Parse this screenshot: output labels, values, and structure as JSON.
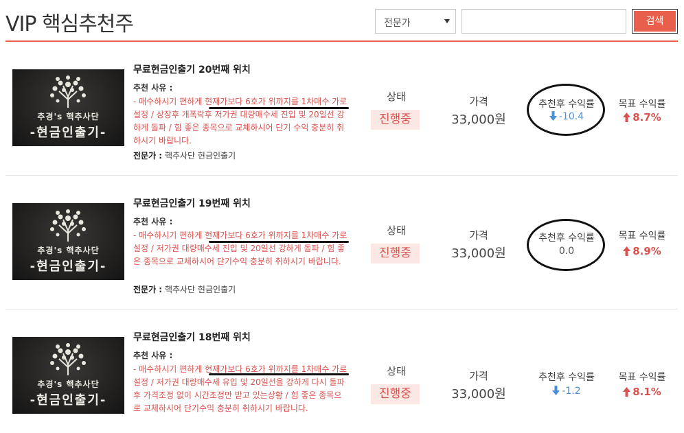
{
  "header": {
    "title": "VIP 핵심추천주",
    "filter": {
      "selected": "전문가"
    },
    "search": {
      "value": "",
      "placeholder": ""
    },
    "search_button": "검색"
  },
  "colors": {
    "accent": "#e8604c",
    "up": "#d9534f",
    "down": "#4a90d9"
  },
  "labels": {
    "reason": "추천 사유 :",
    "expert": "전문가 :",
    "status": "상태",
    "price": "가격",
    "return_after": "추천후 수익률",
    "target_return": "목표 수익률"
  },
  "thumbnail": {
    "line1": "추경's 핵추사단",
    "line2": "-현금인출기-"
  },
  "items": [
    {
      "title": "무료현금인출기 20번째 위치",
      "reason": "- 매수하시기 편하게 현재가보다 6호가 위까지를 1차매수 가로 설정 / 상장후 개폭락후 저가권 대량매수세 진입 및 20일선 강하게 돌파 / 힘 좋은 종목으로 교체하시어 단기 수익 충분히 취하시기 바랍니다.",
      "expert": "핵추사단 현금인출기",
      "status": "진행중",
      "price": "33,000원",
      "return_after": "-10.4",
      "return_direction": "down",
      "target_return": "8.7%"
    },
    {
      "title": "무료현금인출기 19번째 위치",
      "reason": "- 매수하시기 편하게 현재가보다 6호가 위까지를 1차매수 가로 설정 / 저가권 대량매수세 진입 및 20일선 강하게 돌파 / 힘 좋은 종목으로 교체하시어 단기수익 충분히 취하시기 바랍니다.",
      "expert": "핵추사단 현금인출기",
      "status": "진행중",
      "price": "33,000원",
      "return_after": "0.0",
      "return_direction": "neutral",
      "target_return": "8.9%"
    },
    {
      "title": "무료현금인출기 18번째 위치",
      "reason": "- 매수하시기 편하게 현재가보다 6호가 위까지를 1차매수 가로 설정 / 저가권 대량매수세 유입 및 20일선을 강하게 다시 돌파 후 가격조정 없이 시간조정만 받고 있는상황 / 힘 좋은 종목으로 교체하시어 단기수익 충분히 취하시기 바랍니다.",
      "expert": "",
      "status": "진행중",
      "price": "33,000원",
      "return_after": "-1.2",
      "return_direction": "down",
      "target_return": "8.1%"
    }
  ]
}
